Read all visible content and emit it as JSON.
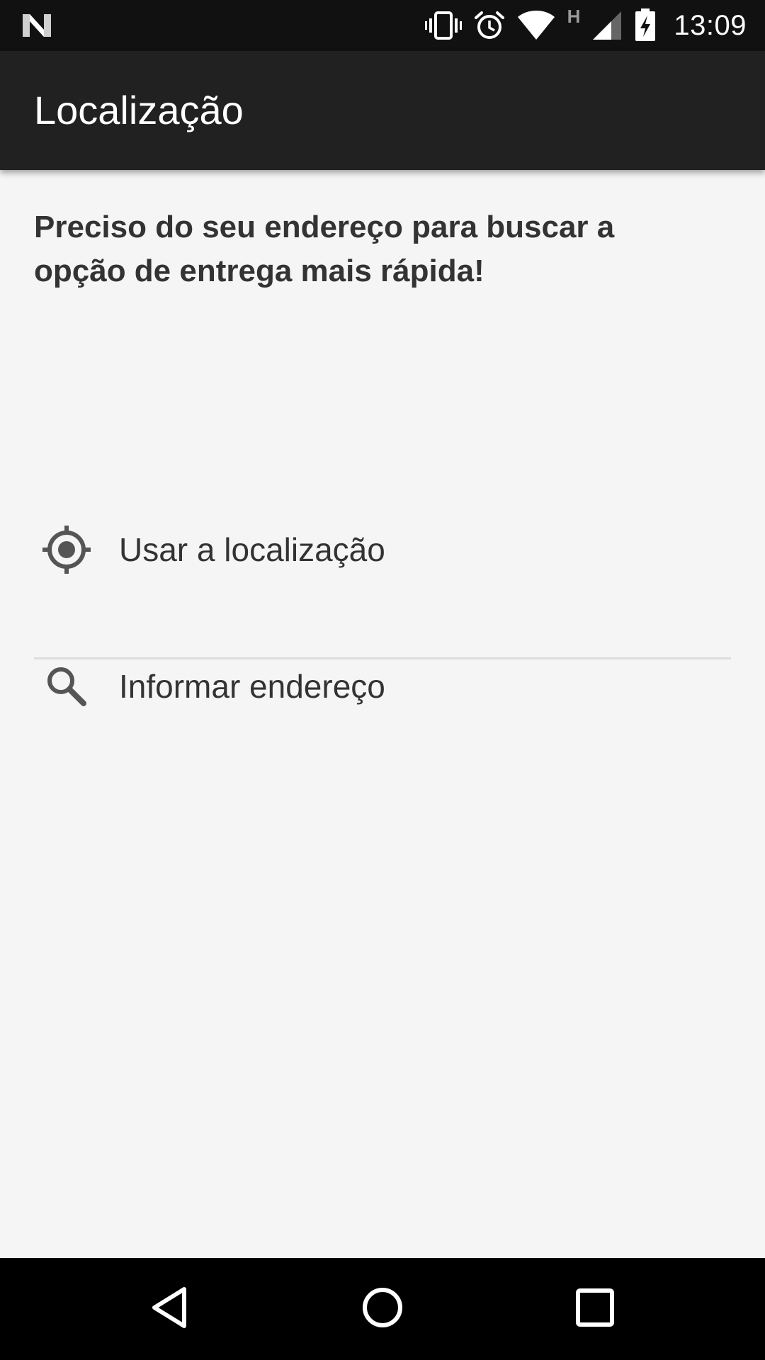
{
  "status_bar": {
    "time": "13:09",
    "network_type": "H",
    "icons": [
      "android-n-icon",
      "vibrate-icon",
      "alarm-icon",
      "wifi-icon",
      "network-type-icon",
      "signal-icon",
      "battery-charging-icon"
    ]
  },
  "app_bar": {
    "title": "Localização"
  },
  "content": {
    "intro_text": "Preciso do seu endereço para buscar a opção de entrega mais rápida!",
    "options": [
      {
        "label": "Usar a localização",
        "icon": "my-location-icon"
      },
      {
        "label": "Informar endereço",
        "icon": "search-icon"
      }
    ]
  },
  "nav_bar": {
    "buttons": [
      "back-icon",
      "home-icon",
      "recents-icon"
    ]
  },
  "colors": {
    "status_bar_bg": "#111111",
    "app_bar_bg": "#212121",
    "content_bg": "#f5f5f5",
    "text_primary": "#333333",
    "icon_color": "#555555",
    "divider": "#dddddd",
    "nav_bar_bg": "#000000"
  }
}
